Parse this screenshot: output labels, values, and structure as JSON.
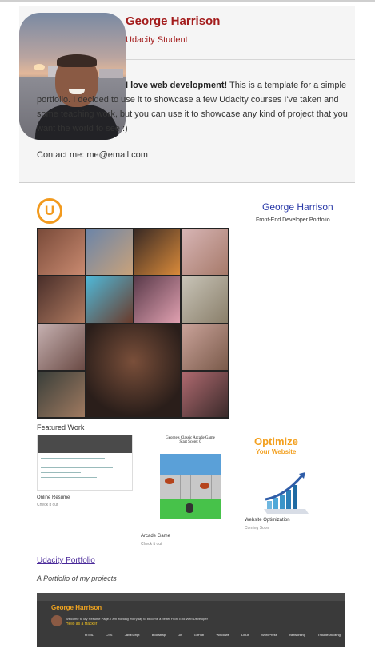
{
  "profile": {
    "name": "George Harrison",
    "role": "Udacity Student",
    "bio_lead": "I love web development!",
    "bio_rest": " This is a template for a simple portfolio. I decided to use it to showcase a few Udacity courses I've taken and some teaching work, but you can use it to showcase any kind of project that you want the world to see :)",
    "contact": "Contact me: me@email.com"
  },
  "project_preview": {
    "logo_letter": "U",
    "name": "George Harrison",
    "subtitle": "Front-End Developer Portfolio",
    "featured_heading": "Featured Work",
    "items": [
      {
        "title": "Online Resume",
        "link": "Check it out"
      },
      {
        "title": "Arcade Game",
        "link": "Check it out",
        "game_title": "George's Classic Arcade Game",
        "game_subtitle": "Start Score: 0"
      },
      {
        "title": "Website Optimization",
        "link": "Coming Soon",
        "graphic_line1": "Optimize",
        "graphic_line2": "Your Website"
      }
    ]
  },
  "project_link": {
    "label": "Udacity Portfolio",
    "tagline": "A Portfolio of my projects"
  },
  "banner": {
    "name": "George Harrison",
    "greeting": "Welcome to My Resume Page. I am working everyday to become a better Front End Web Developer",
    "cta": "Hello as a Hacker",
    "nav": [
      "HTML",
      "CSS",
      "JavaScript",
      "Bootstrap",
      "Git",
      "GitHub",
      "Windows",
      "Linux",
      "WordPress",
      "Networking",
      "Troubleshooting"
    ]
  },
  "colors": {
    "accent_red": "#a31b1b",
    "udacity_orange": "#f29a1e",
    "link_purple": "#4a2a9a"
  }
}
